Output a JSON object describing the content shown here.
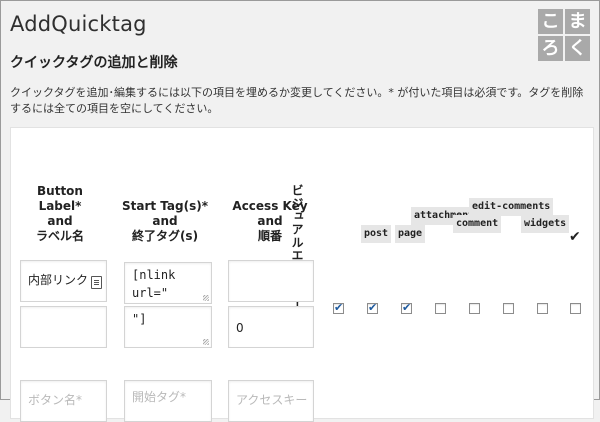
{
  "header": {
    "title": "AddQuicktag",
    "logo": [
      "こ",
      "ま",
      "ろ",
      "く"
    ]
  },
  "section": {
    "subtitle": "クイックタグの追加と削除",
    "description": "クイックタグを追加･編集するには以下の項目を埋めるか変更してください。* が付いた項目は必須です。タグを削除するには全ての項目を空にしてください。"
  },
  "table": {
    "headers": {
      "button_label": [
        "Button Label*",
        "and",
        "ラベル名"
      ],
      "start_tag": [
        "Start Tag(s)* and",
        "終了タグ(s)"
      ],
      "access_key": [
        "Access Key and",
        "順番"
      ],
      "visual": "ビジュアルエディター"
    },
    "post_types": [
      "post",
      "page",
      "attachment",
      "comment",
      "edit-comments",
      "widgets"
    ],
    "select_all_mark": "✔",
    "rows": [
      {
        "label": "内部リンク",
        "start_tag": "[nlink\nurl=\"",
        "end_tag": "\"]",
        "access_key": "",
        "order": "0",
        "checks": [
          true,
          true,
          true,
          false,
          false,
          false,
          false,
          false
        ]
      }
    ],
    "new_row": {
      "label_placeholder": "ボタン名*",
      "start_placeholder": "開始タグ*",
      "access_placeholder": "アクセスキー"
    }
  }
}
